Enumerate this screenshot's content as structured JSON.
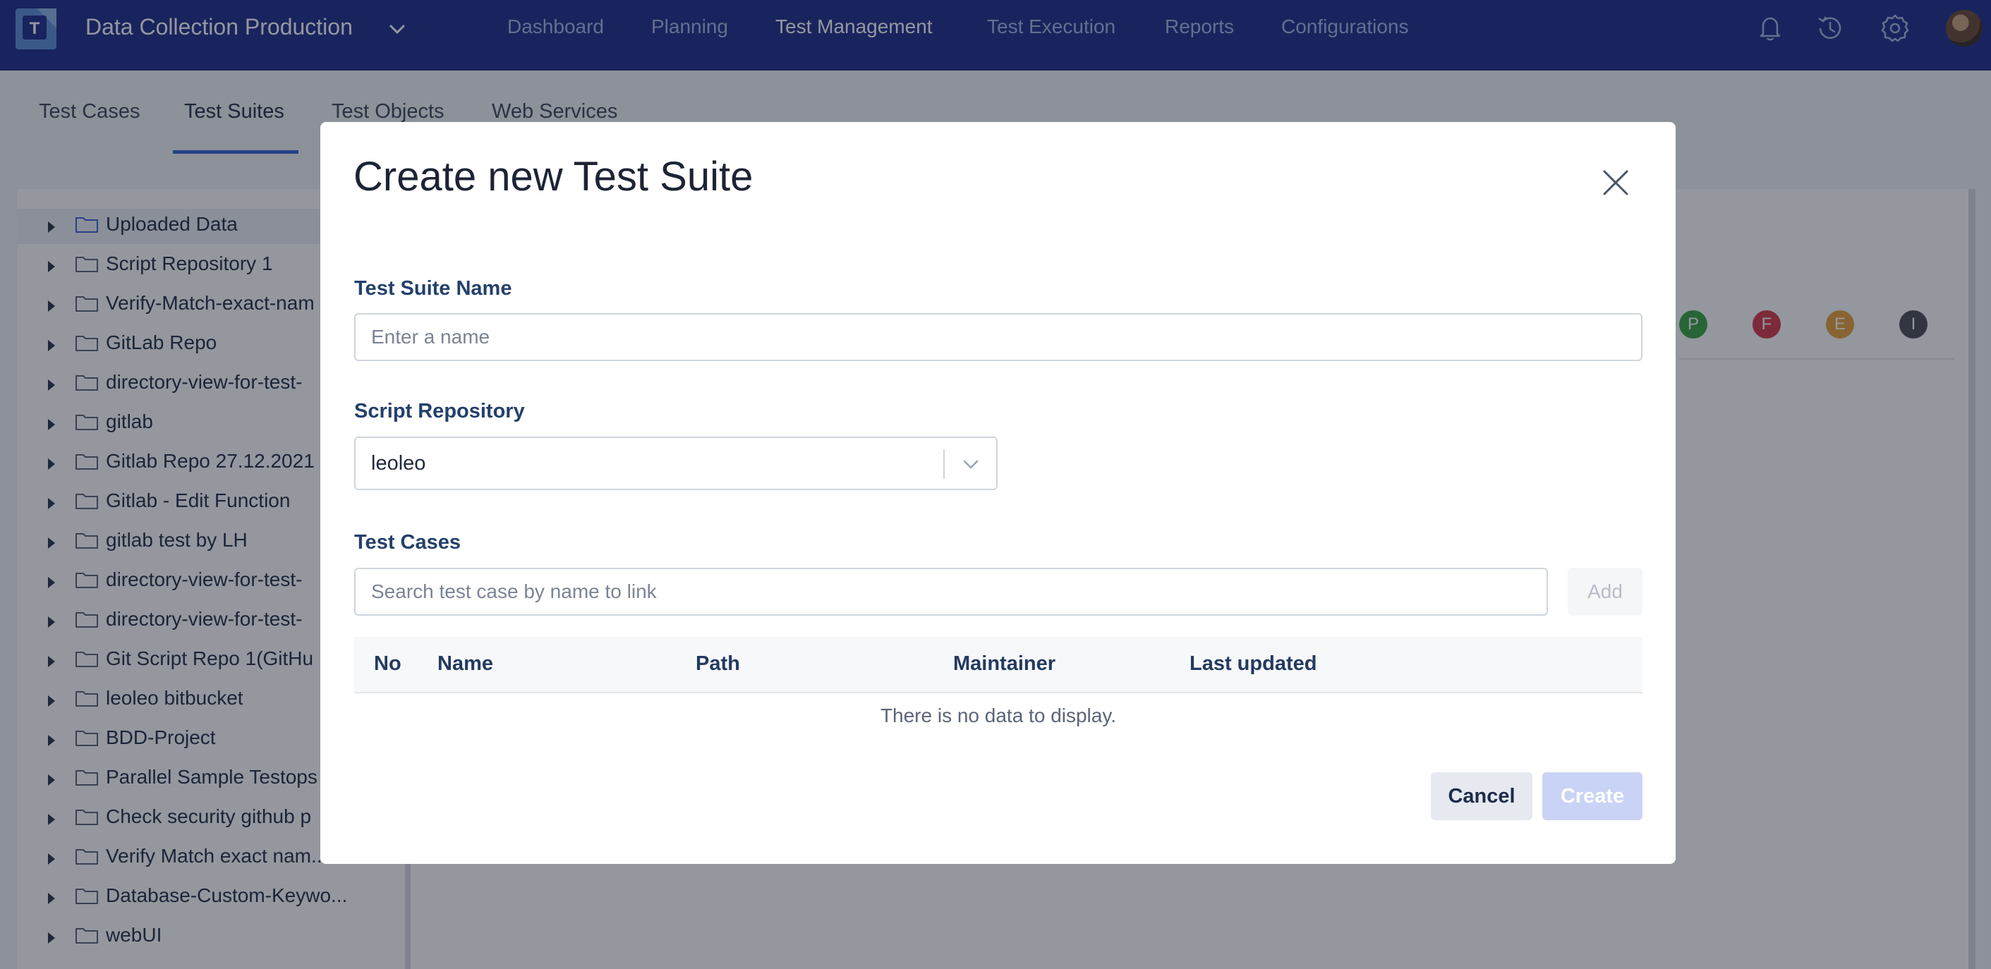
{
  "header": {
    "project_name": "Data Collection Production",
    "nav": [
      {
        "label": "Dashboard"
      },
      {
        "label": "Planning"
      },
      {
        "label": "Test Management"
      },
      {
        "label": "Test Execution"
      },
      {
        "label": "Reports"
      },
      {
        "label": "Configurations"
      }
    ],
    "active_nav": "Test Management",
    "icons": [
      "bell-icon",
      "history-icon",
      "gear-icon"
    ],
    "brand_color": "#1f2f8a"
  },
  "subnav": {
    "tabs": [
      {
        "label": "Test Cases"
      },
      {
        "label": "Test Suites"
      },
      {
        "label": "Test Objects"
      },
      {
        "label": "Web Services"
      }
    ],
    "active_tab": "Test Suites"
  },
  "tree": {
    "items": [
      {
        "label": "Uploaded Data"
      },
      {
        "label": "Script Repository 1"
      },
      {
        "label": "Verify-Match-exact-nam"
      },
      {
        "label": "GitLab Repo"
      },
      {
        "label": "directory-view-for-test-"
      },
      {
        "label": "gitlab"
      },
      {
        "label": "Gitlab Repo 27.12.2021"
      },
      {
        "label": "Gitlab - Edit Function"
      },
      {
        "label": "gitlab test by LH"
      },
      {
        "label": "directory-view-for-test-"
      },
      {
        "label": "directory-view-for-test-"
      },
      {
        "label": "Git Script Repo 1(GitHu"
      },
      {
        "label": "leoleo bitbucket"
      },
      {
        "label": "BDD-Project"
      },
      {
        "label": "Parallel Sample Testops"
      },
      {
        "label": "Check security github p"
      },
      {
        "label": "Verify Match exact nam..."
      },
      {
        "label": "Database-Custom-Keywo..."
      },
      {
        "label": "webUI"
      }
    ]
  },
  "status_legend": [
    {
      "letter": "P",
      "color": "#3aa543"
    },
    {
      "letter": "F",
      "color": "#d63a4a"
    },
    {
      "letter": "E",
      "color": "#e8a23a"
    },
    {
      "letter": "I",
      "color": "#4b4f56"
    }
  ],
  "modal": {
    "title": "Create new Test Suite",
    "suite_name": {
      "label": "Test Suite Name",
      "placeholder": "Enter a name",
      "value": ""
    },
    "script_repository": {
      "label": "Script Repository",
      "value": "leoleo"
    },
    "test_cases": {
      "label": "Test Cases",
      "search_placeholder": "Search test case by name to link",
      "add_label": "Add",
      "columns": [
        "No",
        "Name",
        "Path",
        "Maintainer",
        "Last updated"
      ],
      "empty_message": "There is no data to display."
    },
    "cancel_label": "Cancel",
    "create_label": "Create"
  }
}
